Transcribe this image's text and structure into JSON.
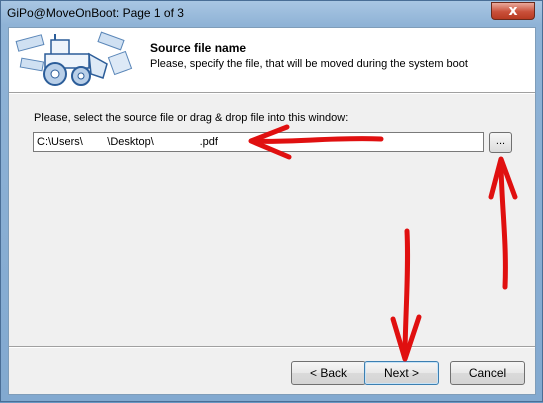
{
  "window": {
    "title": "GiPo@MoveOnBoot: Page 1 of 3",
    "close_glyph": "x"
  },
  "header": {
    "title": "Source file name",
    "subtitle": "Please, specify the file, that will be moved during the system boot",
    "logo_icon": "bulldozer-logo-icon"
  },
  "main": {
    "prompt": "Please, select the source file or drag & drop file into this window:",
    "path_value": "C:\\Users\\        \\Desktop\\               .pdf",
    "browse_label": "..."
  },
  "footer": {
    "back_label": "< Back",
    "next_label": "Next >",
    "cancel_label": "Cancel"
  },
  "annotations": {
    "arrow_color": "#e01010",
    "arrow_icon": "red-hand-drawn-arrow-icon"
  }
}
